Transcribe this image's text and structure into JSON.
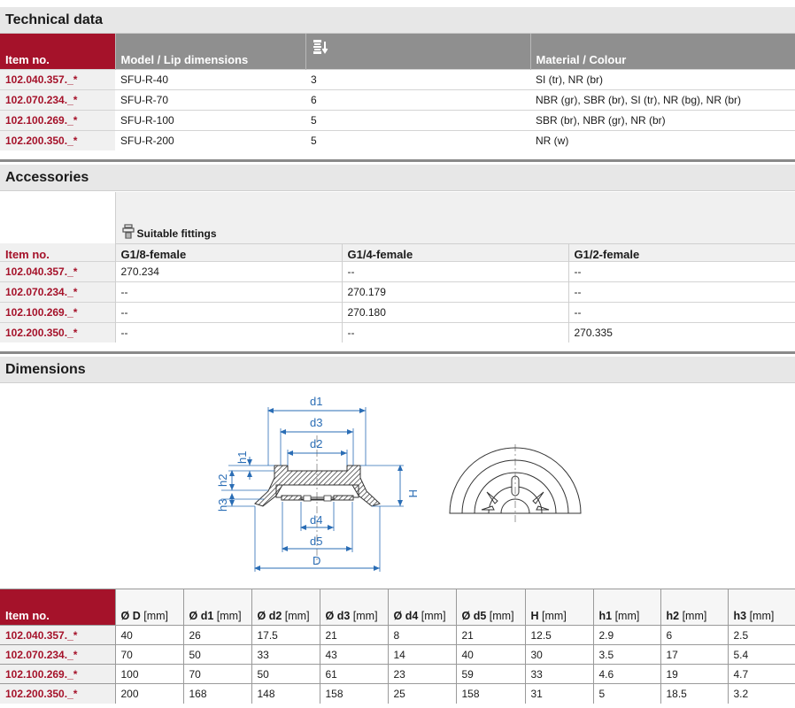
{
  "technical": {
    "title": "Technical data",
    "headers": {
      "item": "Item no.",
      "model": "Model / Lip dimensions",
      "material": "Material / Colour"
    },
    "icon": "bellows-stack-icon",
    "rows": [
      {
        "item": "102.040.357._*",
        "model": "SFU-R-40",
        "value": "3",
        "material": "SI (tr), NR (br)"
      },
      {
        "item": "102.070.234._*",
        "model": "SFU-R-70",
        "value": "6",
        "material": "NBR (gr), SBR (br), SI (tr), NR (bg), NR (br)"
      },
      {
        "item": "102.100.269._*",
        "model": "SFU-R-100",
        "value": "5",
        "material": "SBR (br), NBR (gr), NR (br)"
      },
      {
        "item": "102.200.350._*",
        "model": "SFU-R-200",
        "value": "5",
        "material": "NR (w)"
      }
    ]
  },
  "accessories": {
    "title": "Accessories",
    "group_label": "Suitable fittings",
    "group_icon": "fitting-icon",
    "headers": {
      "item": "Item no.",
      "c1": "G1/8-female",
      "c2": "G1/4-female",
      "c3": "G1/2-female"
    },
    "rows": [
      {
        "item": "102.040.357._*",
        "c1": "270.234",
        "c2": "--",
        "c3": "--"
      },
      {
        "item": "102.070.234._*",
        "c1": "--",
        "c2": "270.179",
        "c3": "--"
      },
      {
        "item": "102.100.269._*",
        "c1": "--",
        "c2": "270.180",
        "c3": "--"
      },
      {
        "item": "102.200.350._*",
        "c1": "--",
        "c2": "--",
        "c3": "270.335"
      }
    ]
  },
  "dimensions": {
    "title": "Dimensions",
    "drawing_labels": {
      "d1": "d1",
      "d2": "d2",
      "d3": "d3",
      "d4": "d4",
      "d5": "d5",
      "D": "D",
      "H": "H",
      "h1": "h1",
      "h2": "h2",
      "h3": "h3"
    },
    "headers": {
      "item": "Item no.",
      "cols": [
        {
          "label": "Ø D",
          "unit": "[mm]"
        },
        {
          "label": "Ø d1",
          "unit": "[mm]"
        },
        {
          "label": "Ø d2",
          "unit": "[mm]"
        },
        {
          "label": "Ø d3",
          "unit": "[mm]"
        },
        {
          "label": "Ø d4",
          "unit": "[mm]"
        },
        {
          "label": "Ø d5",
          "unit": "[mm]"
        },
        {
          "label": "H",
          "unit": "[mm]"
        },
        {
          "label": "h1",
          "unit": "[mm]"
        },
        {
          "label": "h2",
          "unit": "[mm]"
        },
        {
          "label": "h3",
          "unit": "[mm]"
        }
      ]
    },
    "rows": [
      {
        "item": "102.040.357._*",
        "v": [
          "40",
          "26",
          "17.5",
          "21",
          "8",
          "21",
          "12.5",
          "2.9",
          "6",
          "2.5"
        ]
      },
      {
        "item": "102.070.234._*",
        "v": [
          "70",
          "50",
          "33",
          "43",
          "14",
          "40",
          "30",
          "3.5",
          "17",
          "5.4"
        ]
      },
      {
        "item": "102.100.269._*",
        "v": [
          "100",
          "70",
          "50",
          "61",
          "23",
          "59",
          "33",
          "4.6",
          "19",
          "4.7"
        ]
      },
      {
        "item": "102.200.350._*",
        "v": [
          "200",
          "168",
          "148",
          "158",
          "25",
          "158",
          "31",
          "5",
          "18.5",
          "3.2"
        ]
      }
    ]
  },
  "colors": {
    "accent": "#a5122a",
    "header_grey": "#8f8f8f",
    "dimension_blue": "#2a6db5"
  }
}
